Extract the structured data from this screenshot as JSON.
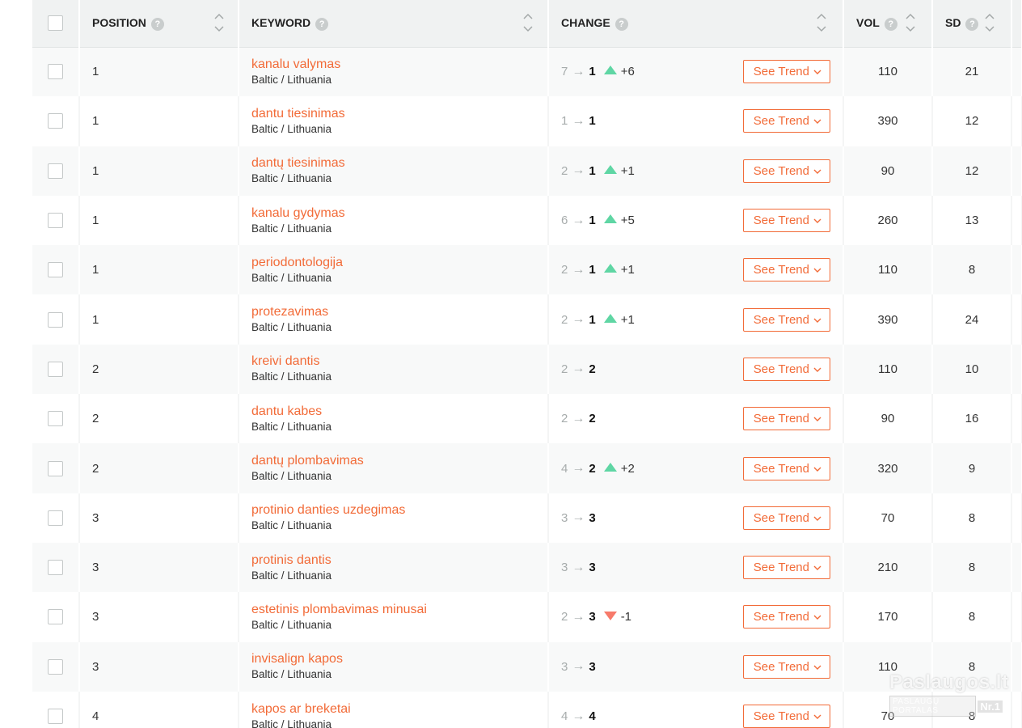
{
  "columns": {
    "position": "POSITION",
    "keyword": "KEYWORD",
    "change": "CHANGE",
    "vol": "VOL",
    "sd": "SD",
    "help_glyph": "?"
  },
  "trend_button_label": "See Trend",
  "arrow_glyph": "→",
  "colors": {
    "accent": "#f26b38",
    "up": "#5fd6a4",
    "down": "#f77a6a"
  },
  "rows": [
    {
      "position": "1",
      "keyword": "kanalu valymas",
      "location": "Baltic / Lithuania",
      "prev": "7",
      "curr": "1",
      "dir": "up",
      "delta": "+6",
      "vol": "110",
      "sd": "21"
    },
    {
      "position": "1",
      "keyword": "dantu tiesinimas",
      "location": "Baltic / Lithuania",
      "prev": "1",
      "curr": "1",
      "dir": "none",
      "delta": "",
      "vol": "390",
      "sd": "12"
    },
    {
      "position": "1",
      "keyword": "dantų tiesinimas",
      "location": "Baltic / Lithuania",
      "prev": "2",
      "curr": "1",
      "dir": "up",
      "delta": "+1",
      "vol": "90",
      "sd": "12"
    },
    {
      "position": "1",
      "keyword": "kanalu gydymas",
      "location": "Baltic / Lithuania",
      "prev": "6",
      "curr": "1",
      "dir": "up",
      "delta": "+5",
      "vol": "260",
      "sd": "13"
    },
    {
      "position": "1",
      "keyword": "periodontologija",
      "location": "Baltic / Lithuania",
      "prev": "2",
      "curr": "1",
      "dir": "up",
      "delta": "+1",
      "vol": "110",
      "sd": "8"
    },
    {
      "position": "1",
      "keyword": "protezavimas",
      "location": "Baltic / Lithuania",
      "prev": "2",
      "curr": "1",
      "dir": "up",
      "delta": "+1",
      "vol": "390",
      "sd": "24"
    },
    {
      "position": "2",
      "keyword": "kreivi dantis",
      "location": "Baltic / Lithuania",
      "prev": "2",
      "curr": "2",
      "dir": "none",
      "delta": "",
      "vol": "110",
      "sd": "10"
    },
    {
      "position": "2",
      "keyword": "dantu kabes",
      "location": "Baltic / Lithuania",
      "prev": "2",
      "curr": "2",
      "dir": "none",
      "delta": "",
      "vol": "90",
      "sd": "16"
    },
    {
      "position": "2",
      "keyword": "dantų plombavimas",
      "location": "Baltic / Lithuania",
      "prev": "4",
      "curr": "2",
      "dir": "up",
      "delta": "+2",
      "vol": "320",
      "sd": "9"
    },
    {
      "position": "3",
      "keyword": "protinio danties uzdegimas",
      "location": "Baltic / Lithuania",
      "prev": "3",
      "curr": "3",
      "dir": "none",
      "delta": "",
      "vol": "70",
      "sd": "8"
    },
    {
      "position": "3",
      "keyword": "protinis dantis",
      "location": "Baltic / Lithuania",
      "prev": "3",
      "curr": "3",
      "dir": "none",
      "delta": "",
      "vol": "210",
      "sd": "8"
    },
    {
      "position": "3",
      "keyword": "estetinis plombavimas minusai",
      "location": "Baltic / Lithuania",
      "prev": "2",
      "curr": "3",
      "dir": "down",
      "delta": "-1",
      "vol": "170",
      "sd": "8"
    },
    {
      "position": "3",
      "keyword": "invisalign kapos",
      "location": "Baltic / Lithuania",
      "prev": "3",
      "curr": "3",
      "dir": "none",
      "delta": "",
      "vol": "110",
      "sd": "8"
    },
    {
      "position": "4",
      "keyword": "kapos ar breketai",
      "location": "Baltic / Lithuania",
      "prev": "4",
      "curr": "4",
      "dir": "none",
      "delta": "",
      "vol": "70",
      "sd": "8"
    }
  ],
  "watermark": {
    "title": "Paslaugos.lt",
    "subtitle": "PASLAUGŲ PORTALAS",
    "badge": "Nr.1"
  }
}
